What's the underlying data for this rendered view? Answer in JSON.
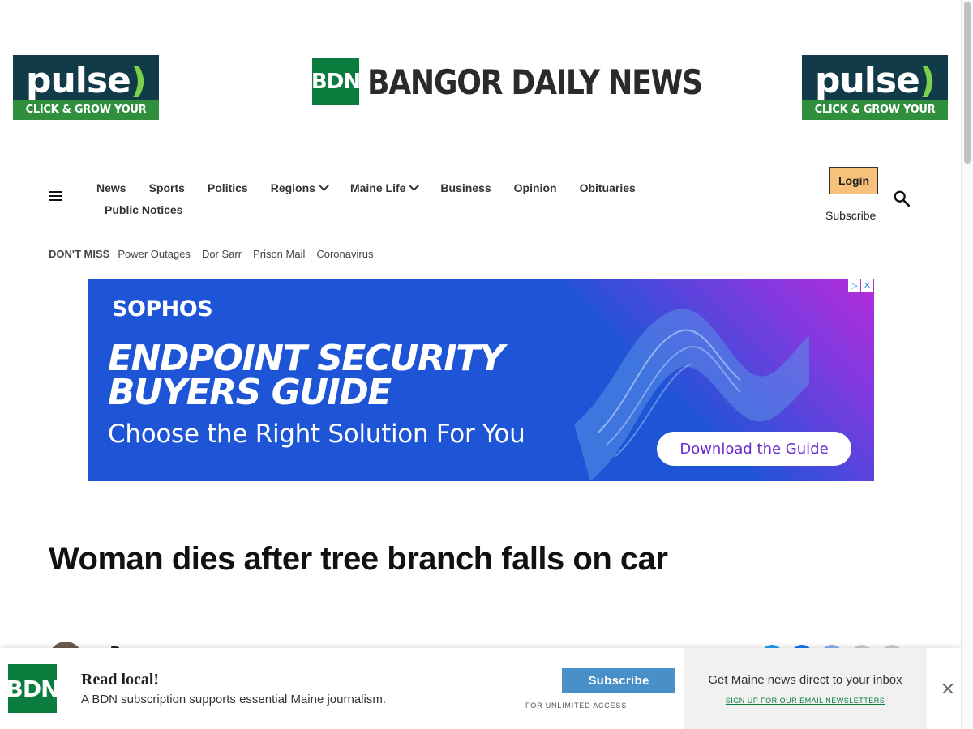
{
  "ads": {
    "pulse_left": {
      "word": "pulse",
      "paren": ")",
      "tagline": "CLICK & GROW YOUR BUSINESS"
    },
    "pulse_right": {
      "word": "pulse",
      "paren": ")",
      "tagline": "CLICK & GROW YOUR BUSINESS"
    },
    "banner": {
      "brand": "SOPHOS",
      "headline_line1": "ENDPOINT SECURITY",
      "headline_line2": "BUYERS GUIDE",
      "subhead": "Choose the Right Solution For You",
      "cta": "Download the Guide",
      "adchoices_play": "▷",
      "adchoices_close": "✕",
      "colors": {
        "background": "#1d55d6",
        "accent": "#b62bd9",
        "cta_text": "#6a2bd0"
      }
    }
  },
  "logo": {
    "mark": "BDN",
    "name": "BANGOR DAILY NEWS",
    "color": "#0a7c3e"
  },
  "nav": {
    "menu_icon": "hamburger-menu-icon",
    "row1": [
      {
        "label": "News",
        "dropdown": false
      },
      {
        "label": "Sports",
        "dropdown": false
      },
      {
        "label": "Politics",
        "dropdown": false
      },
      {
        "label": "Regions",
        "dropdown": true
      },
      {
        "label": "Maine Life",
        "dropdown": true
      },
      {
        "label": "Business",
        "dropdown": false
      },
      {
        "label": "Opinion",
        "dropdown": false
      },
      {
        "label": "Obituaries",
        "dropdown": false
      }
    ],
    "row2": [
      {
        "label": "Public Notices",
        "dropdown": false
      }
    ],
    "login": "Login",
    "subscribe": "Subscribe",
    "search_icon": "search-icon"
  },
  "dont_miss": {
    "label": "DON'T MISS",
    "links": [
      "Power Outages",
      "Dor Sarr",
      "Prison Mail",
      "Coronavirus"
    ]
  },
  "article": {
    "headline": "Woman dies after tree branch falls on car",
    "author_peek": "By"
  },
  "bottom_bar": {
    "logo": "BDN",
    "title": "Read local!",
    "description": "A BDN subscription supports essential Maine journalism.",
    "subscribe": "Subscribe",
    "unlimited": "FOR UNLIMITED ACCESS",
    "newsletter_title": "Get Maine news direct to your inbox",
    "newsletter_link": "SIGN UP FOR OUR EMAIL NEWSLETTERS",
    "close_icon": "close-icon"
  }
}
